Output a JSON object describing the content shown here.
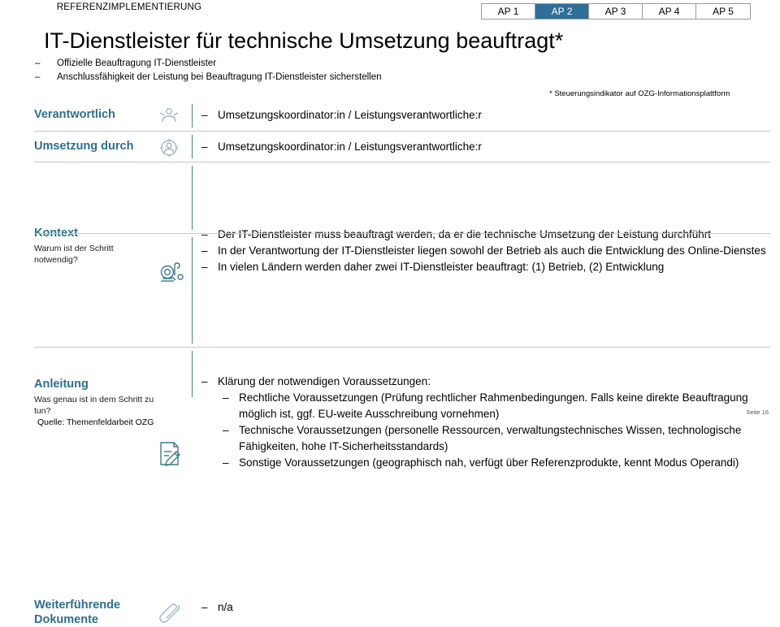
{
  "header": {
    "eyebrow": "REFERENZIMPLEMENTIERUNG",
    "title": "IT-Dienstleister für technische Umsetzung beauftragt*",
    "subbullets": [
      "Offizielle Beauftragung IT-Dienstleister",
      "Anschlussfähigkeit der Leistung bei Beauftragung IT-Dienstleister sicherstellen"
    ],
    "footnote": "* Steuerungsindikator auf OZG-Informationsplattform"
  },
  "tabs": {
    "items": [
      {
        "label": "AP 1",
        "active": false
      },
      {
        "label": "AP 2",
        "active": true
      },
      {
        "label": "AP 3",
        "active": false
      },
      {
        "label": "AP 4",
        "active": false
      },
      {
        "label": "AP 5",
        "active": false
      }
    ],
    "active_color": "#2E6E99"
  },
  "rows": {
    "verantwortlich": {
      "label": "Verantwortlich",
      "icon": "people-icon",
      "bullets": [
        "Umsetzungskoordinator:in / Leistungsverantwortliche:r"
      ]
    },
    "umsetzung": {
      "label": "Umsetzung durch",
      "icon": "gear-person-icon",
      "bullets": [
        "Umsetzungskoordinator:in / Leistungsverantwortliche:r"
      ]
    },
    "kontext": {
      "label": "Kontext",
      "sublabel": "Warum ist der Schritt notwendig?",
      "icon": "magnifier-document-icon",
      "bullets": [
        "Der IT-Dienstleister muss beauftragt werden, da er die technische Umsetzung der Leistung durchführt",
        "In der Verantwortung der IT-Dienstleister liegen sowohl der Betrieb als auch die Entwicklung des Online-Dienstes",
        "In vielen Ländern werden daher zwei IT-Dienstleister beauftragt: (1) Betrieb, (2) Entwicklung"
      ]
    },
    "anleitung": {
      "label": "Anleitung",
      "sublabel": "Was genau ist in dem Schritt zu tun?",
      "icon": "document-pencil-icon",
      "bullets": [
        "Klärung der notwendigen Voraussetzungen:"
      ],
      "subbullets": [
        "Rechtliche Voraussetzungen (Prüfung rechtlicher Rahmenbedingungen. Falls keine direkte Beauftragung möglich ist, ggf. EU-weite Ausschreibung vornehmen)",
        "Technische Voraussetzungen (personelle Ressourcen, verwaltungstechnisches Wissen, technologische Fähigkeiten, hohe IT-Sicherheitsstandards)",
        "Sonstige Voraussetzungen (geographisch nah, verfügt über Referenzprodukte, kennt Modus Operandi)"
      ]
    },
    "dokumente": {
      "label_line1": "Weiterführende",
      "label_line2": "Dokumente",
      "icon": "paperclip-icon",
      "bullets": [
        "n/a"
      ]
    }
  },
  "footer": {
    "source": "Quelle: Themenfeldarbeit OZG",
    "page": "Seite 16"
  },
  "colors": {
    "label": "#2E6E8E",
    "rule": "#c8c8c8",
    "vrule": "#4a7f8c"
  }
}
